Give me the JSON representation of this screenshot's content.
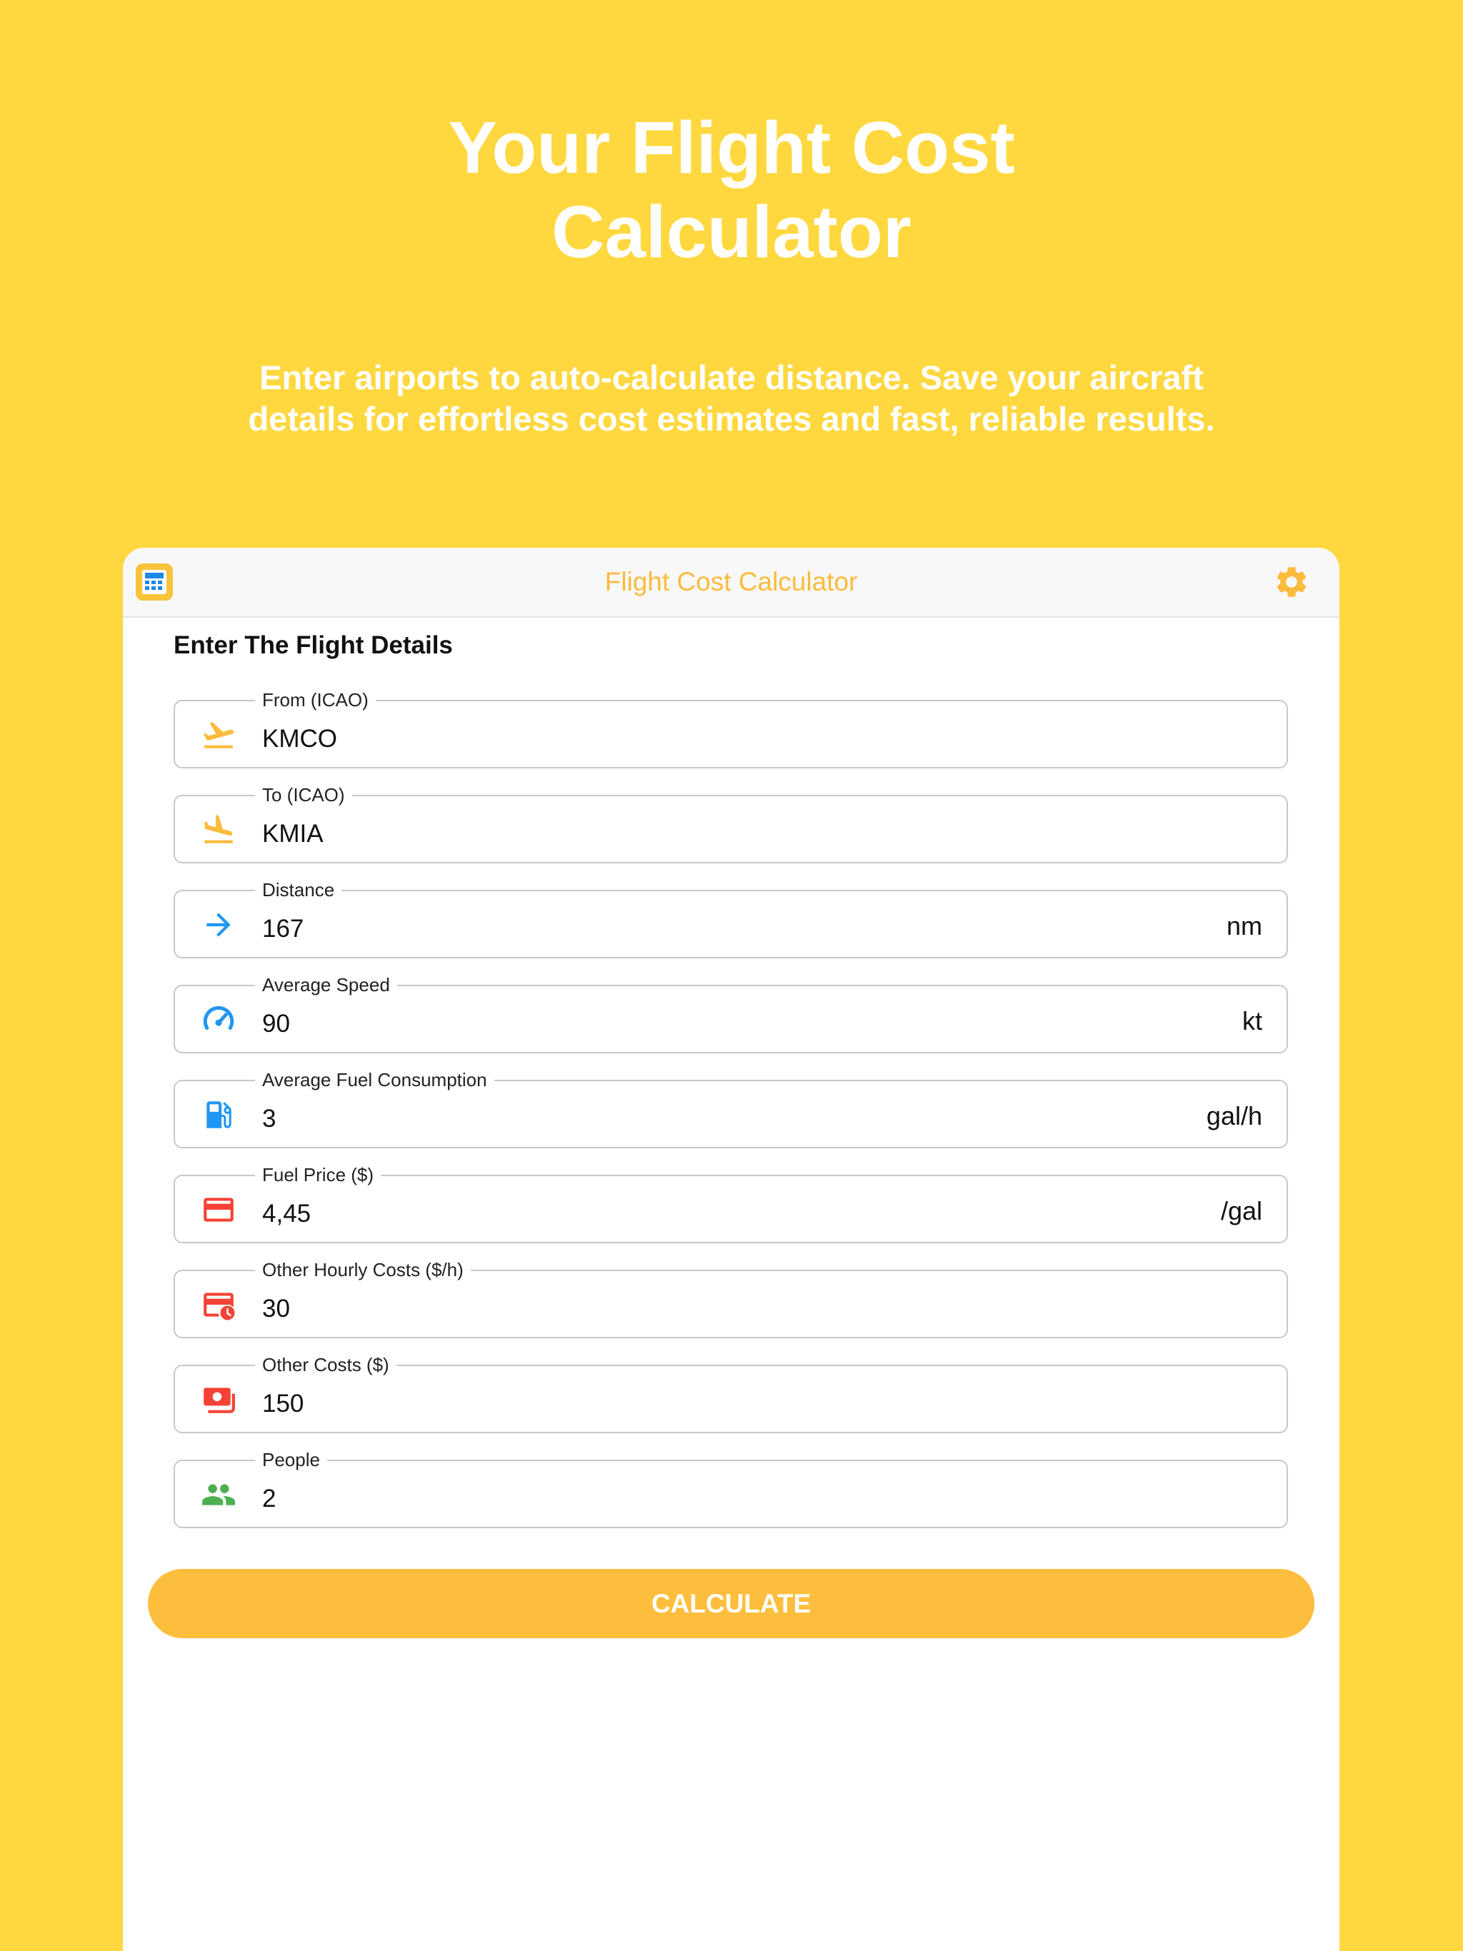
{
  "hero": {
    "title_line1": "Your Flight Cost",
    "title_line2": "Calculator",
    "subtitle_line1": "Enter airports to auto-calculate distance. Save your aircraft",
    "subtitle_line2": "details for effortless cost estimates and fast, reliable results."
  },
  "appbar": {
    "title": "Flight Cost Calculator",
    "app_icon": "calculator-icon",
    "settings_icon": "gear-icon"
  },
  "form": {
    "section_title": "Enter The Flight Details",
    "fields": [
      {
        "label": "From (ICAO)",
        "value": "KMCO",
        "unit": "",
        "icon": "takeoff-icon"
      },
      {
        "label": "To (ICAO)",
        "value": "KMIA",
        "unit": "",
        "icon": "landing-icon"
      },
      {
        "label": "Distance",
        "value": "167",
        "unit": "nm",
        "icon": "arrow-right-icon"
      },
      {
        "label": "Average Speed",
        "value": "90",
        "unit": "kt",
        "icon": "speedometer-icon"
      },
      {
        "label": "Average Fuel Consumption",
        "value": "3",
        "unit": "gal/h",
        "icon": "fuel-pump-icon"
      },
      {
        "label": "Fuel Price ($)",
        "value": "4,45",
        "unit": "/gal",
        "icon": "credit-card-icon"
      },
      {
        "label": "Other Hourly Costs ($/h)",
        "value": "30",
        "unit": "",
        "icon": "card-clock-icon"
      },
      {
        "label": "Other Costs ($)",
        "value": "150",
        "unit": "",
        "icon": "cash-icon"
      },
      {
        "label": "People",
        "value": "2",
        "unit": "",
        "icon": "people-icon"
      }
    ],
    "calculate_label": "CALCULATE"
  },
  "colors": {
    "background": "#FFD83F",
    "accent": "#FDBE3D",
    "blue_icon": "#2196F3",
    "red_icon": "#F44336",
    "green_icon": "#4CAF50"
  }
}
